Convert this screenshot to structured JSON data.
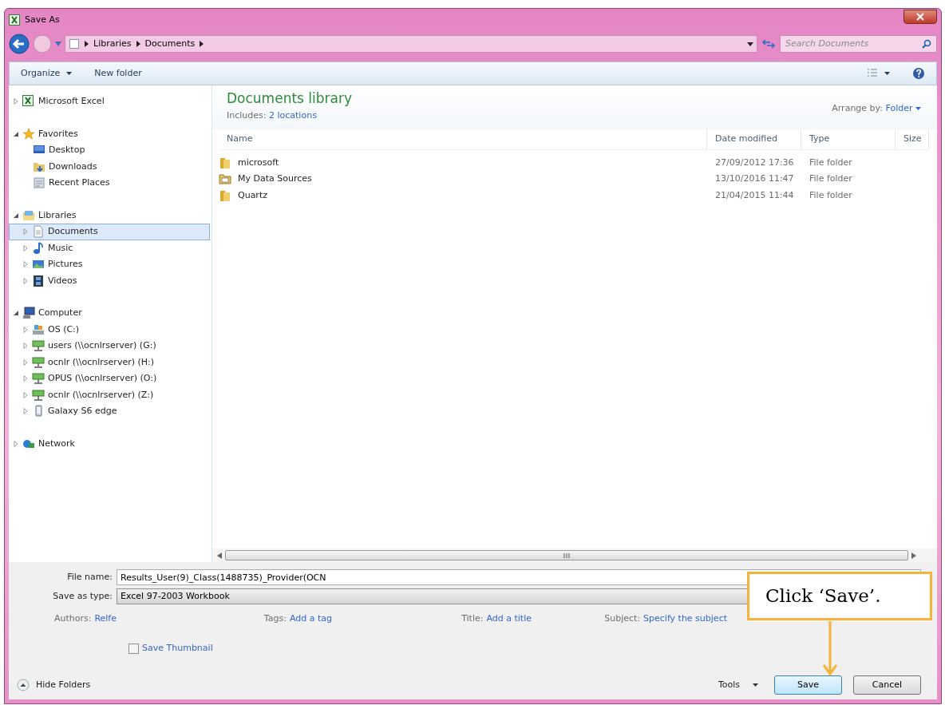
{
  "window": {
    "title": "Save As"
  },
  "address": {
    "crumbs": [
      "Libraries",
      "Documents"
    ],
    "search_placeholder": "Search Documents"
  },
  "toolbar": {
    "buttons": [
      "Organize",
      "New folder"
    ]
  },
  "sidebar": {
    "items": [
      {
        "label": "Microsoft Excel",
        "kind": "excel",
        "expanded": false,
        "selected": false
      },
      {
        "label": "Favorites",
        "kind": "favorites",
        "expanded": true,
        "selected": false,
        "children": [
          {
            "label": "Desktop",
            "kind": "desktop",
            "selected": false
          },
          {
            "label": "Downloads",
            "kind": "downloads",
            "selected": false
          },
          {
            "label": "Recent Places",
            "kind": "recent",
            "selected": false
          }
        ]
      },
      {
        "label": "Libraries",
        "kind": "libraries",
        "expanded": true,
        "selected": false,
        "children": [
          {
            "label": "Documents",
            "kind": "documents",
            "expanded": false,
            "selected": true
          },
          {
            "label": "Music",
            "kind": "music",
            "expanded": false,
            "selected": false
          },
          {
            "label": "Pictures",
            "kind": "pictures",
            "expanded": false,
            "selected": false
          },
          {
            "label": "Videos",
            "kind": "videos",
            "expanded": false,
            "selected": false
          }
        ]
      },
      {
        "label": "Computer",
        "kind": "computer",
        "expanded": true,
        "selected": false,
        "children": [
          {
            "label": "OS (C:)",
            "kind": "disk",
            "expanded": false,
            "selected": false
          },
          {
            "label": "users (\\\\ocnlrserver) (G:)",
            "kind": "netdrive",
            "expanded": false,
            "selected": false
          },
          {
            "label": "ocnlr (\\\\ocnlrserver) (H:)",
            "kind": "netdrive",
            "expanded": false,
            "selected": false
          },
          {
            "label": "OPUS (\\\\ocnlrserver) (O:)",
            "kind": "netdrive",
            "expanded": false,
            "selected": false
          },
          {
            "label": "ocnlr (\\\\ocnlrserver) (Z:)",
            "kind": "netdrive",
            "expanded": false,
            "selected": false
          },
          {
            "label": "Galaxy S6 edge",
            "kind": "phone",
            "expanded": false,
            "selected": false
          }
        ]
      },
      {
        "label": "Network",
        "kind": "network",
        "expanded": false,
        "selected": false
      }
    ]
  },
  "content": {
    "title": "Documents library",
    "includes_label": "Includes:",
    "includes_link": "2 locations",
    "arrange_label": "Arrange by:",
    "arrange_value": "Folder",
    "columns": [
      "Name",
      "Date modified",
      "Type",
      "Size"
    ],
    "rows": [
      {
        "name": "microsoft",
        "date": "27/09/2012 17:36",
        "type": "File folder",
        "kind": "folder"
      },
      {
        "name": "My Data Sources",
        "date": "13/10/2016 11:47",
        "type": "File folder",
        "kind": "special"
      },
      {
        "name": "Quartz",
        "date": "21/04/2015 11:44",
        "type": "File folder",
        "kind": "folder"
      }
    ]
  },
  "form": {
    "file_name_label": "File name:",
    "file_name": "Results_User(9)_Class(1488735)_Provider(OCN",
    "type_label": "Save as type:",
    "type_value": "Excel 97-2003 Workbook",
    "meta": [
      {
        "label": "Authors:",
        "value": "Relfe"
      },
      {
        "label": "Tags:",
        "value": "Add a tag"
      },
      {
        "label": "Title:",
        "value": "Add a title"
      },
      {
        "label": "Subject:",
        "value": "Specify the subject"
      }
    ],
    "thumbnail": {
      "label": "Save Thumbnail",
      "checked": false
    }
  },
  "footer": {
    "hide_folders": "Hide Folders",
    "tools": "Tools",
    "save": "Save",
    "cancel": "Cancel"
  },
  "callout": {
    "text": "Click ‘Save’."
  }
}
